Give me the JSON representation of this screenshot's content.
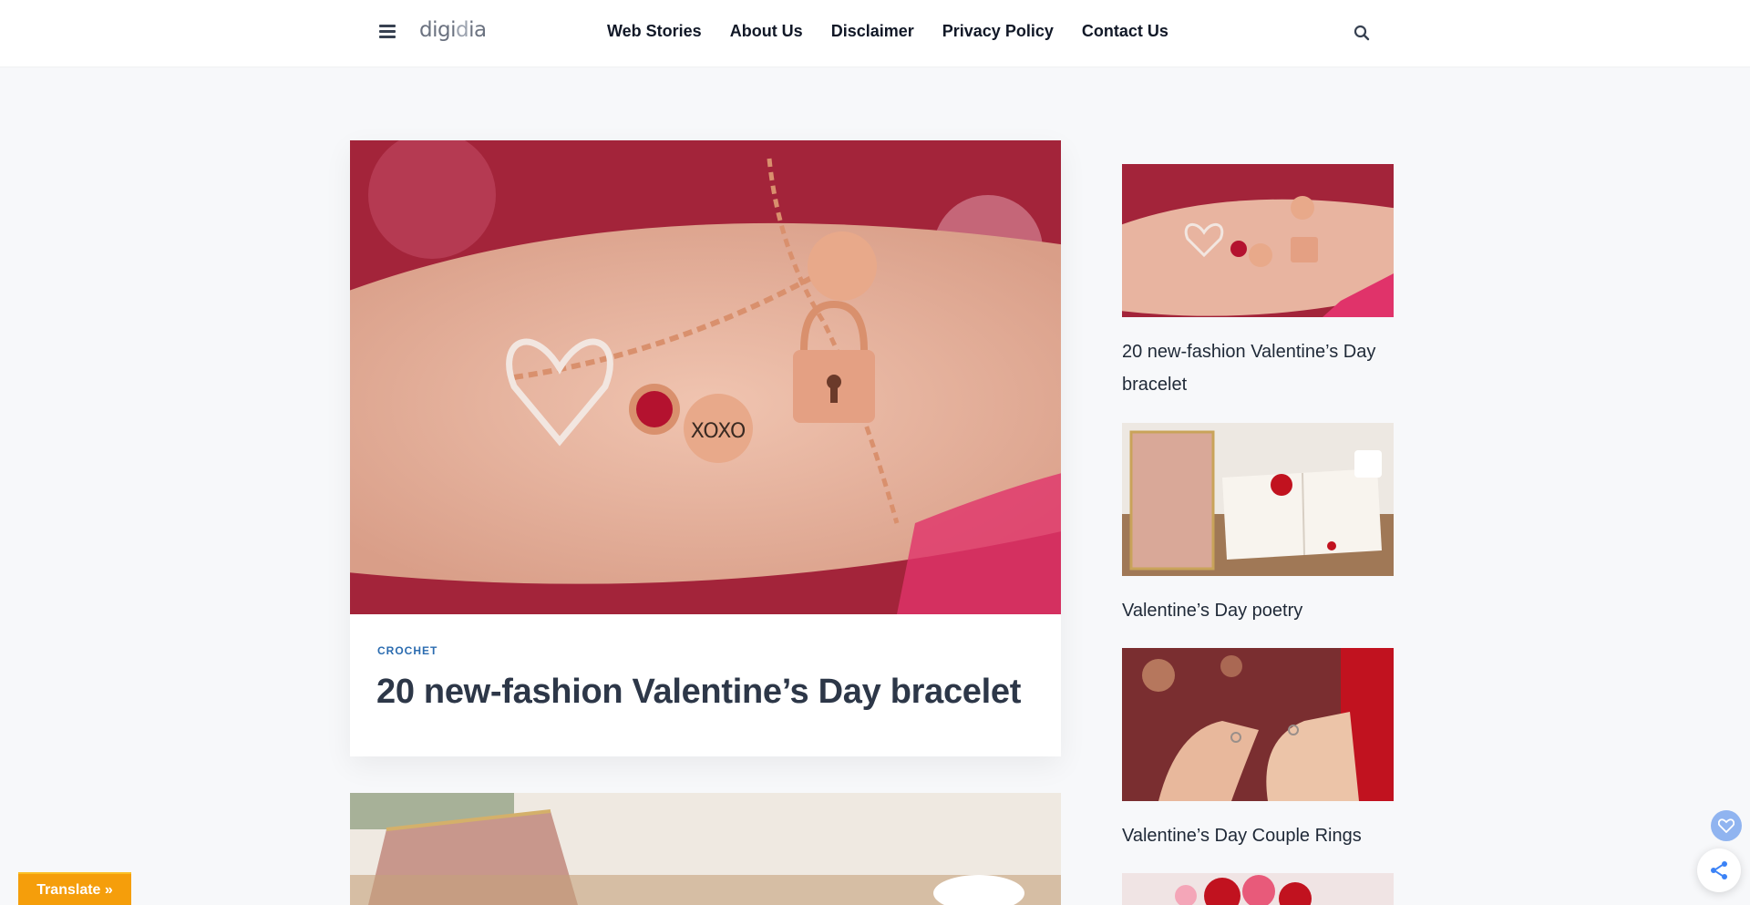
{
  "header": {
    "logo": {
      "part1": "digi",
      "part2": "d",
      "part3": "ia"
    },
    "nav": [
      "Web Stories",
      "About Us",
      "Disclaimer",
      "Privacy Policy",
      "Contact Us"
    ],
    "icons": {
      "menu": "hamburger-icon",
      "search": "search-icon"
    }
  },
  "featured": {
    "category": "CROCHET",
    "title": "20 new-fashion Valentine’s Day bracelet"
  },
  "sidebar": {
    "items": [
      {
        "title": "20 new-fashion Valentine’s Day bracelet"
      },
      {
        "title": "Valentine’s Day poetry"
      },
      {
        "title": "Valentine’s Day Couple Rings"
      }
    ]
  },
  "floating": {
    "translate": "Translate »",
    "heart_icon": "heart-icon",
    "share_icon": "share-icon"
  },
  "colors": {
    "accent": "#2b6cb0",
    "translate_bg": "#f59e0b",
    "heart_bg": "#90b4f0"
  }
}
